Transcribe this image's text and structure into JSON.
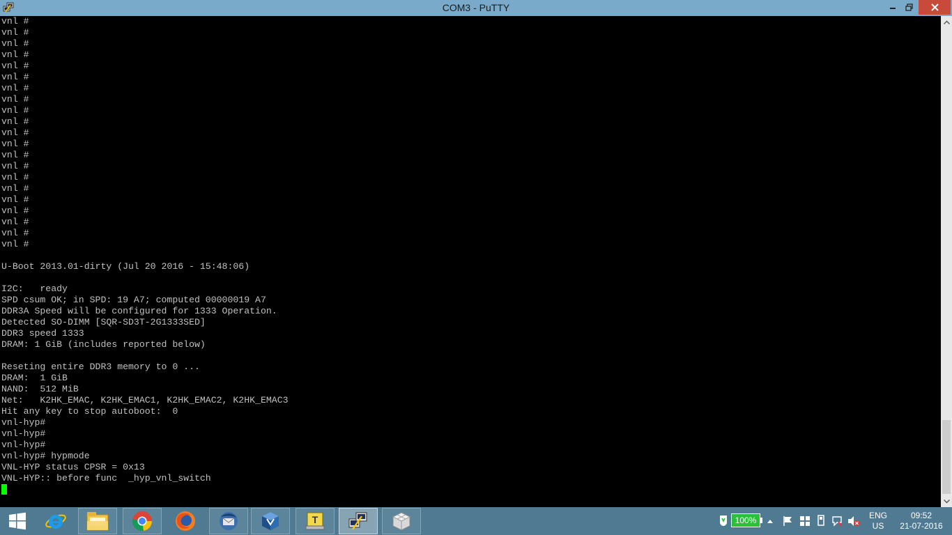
{
  "window": {
    "title": "COM3 - PuTTY",
    "controls": {
      "minimize": "minimize-icon",
      "maximize": "restore-icon",
      "close": "close-icon"
    }
  },
  "terminal": {
    "lines": [
      "vnl #",
      "vnl #",
      "vnl #",
      "vnl #",
      "vnl #",
      "vnl #",
      "vnl #",
      "vnl #",
      "vnl #",
      "vnl #",
      "vnl #",
      "vnl #",
      "vnl #",
      "vnl #",
      "vnl #",
      "vnl #",
      "vnl #",
      "vnl #",
      "vnl #",
      "vnl #",
      "vnl #",
      "",
      "U-Boot 2013.01-dirty (Jul 20 2016 - 15:48:06)",
      "",
      "I2C:   ready",
      "SPD csum OK; in SPD: 19 A7; computed 00000019 A7",
      "DDR3A Speed will be configured for 1333 Operation.",
      "Detected SO-DIMM [SQR-SD3T-2G1333SED]",
      "DDR3 speed 1333",
      "DRAM: 1 GiB (includes reported below)",
      "",
      "Reseting entire DDR3 memory to 0 ...",
      "DRAM:  1 GiB",
      "NAND:  512 MiB",
      "Net:   K2HK_EMAC, K2HK_EMAC1, K2HK_EMAC2, K2HK_EMAC3",
      "Hit any key to stop autoboot:  0",
      "vnl-hyp#",
      "vnl-hyp#",
      "vnl-hyp#",
      "vnl-hyp# hypmode",
      "VNL-HYP status CPSR = 0x13",
      "VNL-HYP:: before func  _hyp_vnl_switch"
    ],
    "colors": {
      "foreground": "#c0c0c0",
      "background": "#000000",
      "cursor": "#00ff00"
    }
  },
  "taskbar": {
    "apps": [
      {
        "name": "internet-explorer-icon"
      },
      {
        "name": "file-explorer-icon"
      },
      {
        "name": "chrome-icon"
      },
      {
        "name": "firefox-icon"
      },
      {
        "name": "thunderbird-icon"
      },
      {
        "name": "virtualbox-icon"
      },
      {
        "name": "terminal-tool-icon"
      },
      {
        "name": "putty-icon",
        "active": true
      },
      {
        "name": "cube-app-icon"
      }
    ],
    "battery": "100%",
    "language": {
      "line1": "ENG",
      "line2": "US"
    },
    "clock": {
      "time": "09:52",
      "date": "21-07-2016"
    }
  }
}
